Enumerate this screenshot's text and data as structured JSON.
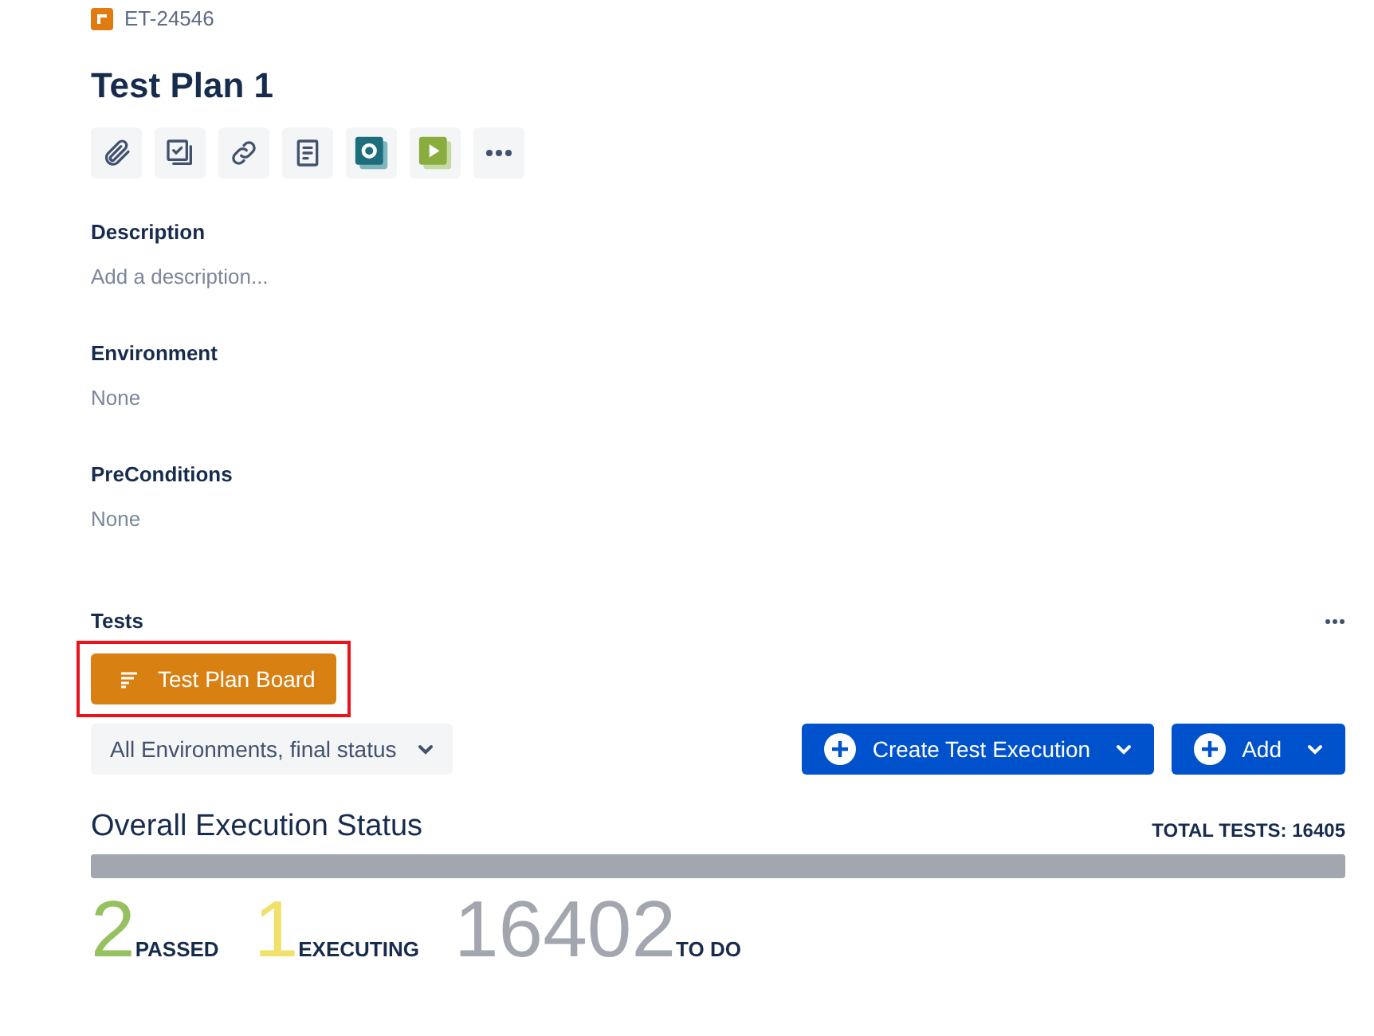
{
  "issue": {
    "key": "ET-24546",
    "title": "Test Plan 1"
  },
  "toolbar": [
    {
      "kind": "attach"
    },
    {
      "kind": "subtask"
    },
    {
      "kind": "link"
    },
    {
      "kind": "page"
    },
    {
      "kind": "teal"
    },
    {
      "kind": "green"
    },
    {
      "kind": "more"
    }
  ],
  "fields": [
    {
      "label": "Description",
      "value": "Add a description..."
    },
    {
      "label": "Environment",
      "value": "None"
    },
    {
      "label": "PreConditions",
      "value": "None"
    }
  ],
  "tests": {
    "label": "Tests",
    "board_button": {
      "label": "Test Plan Board",
      "highlighted": true
    },
    "filter": {
      "value": "All Environments, final status"
    },
    "create_button": "Create Test Execution",
    "add_button": "Add",
    "title": "Overall Execution Status",
    "total": "TOTAL TESTS: 16405",
    "statuses": [
      {
        "count": "2",
        "label": "PASSED",
        "color": "#95c160"
      },
      {
        "count": "1",
        "label": "EXECUTING",
        "color": "#f1e069"
      },
      {
        "count": "16402",
        "label": "TO DO",
        "color": "#a2a6ae"
      }
    ]
  }
}
